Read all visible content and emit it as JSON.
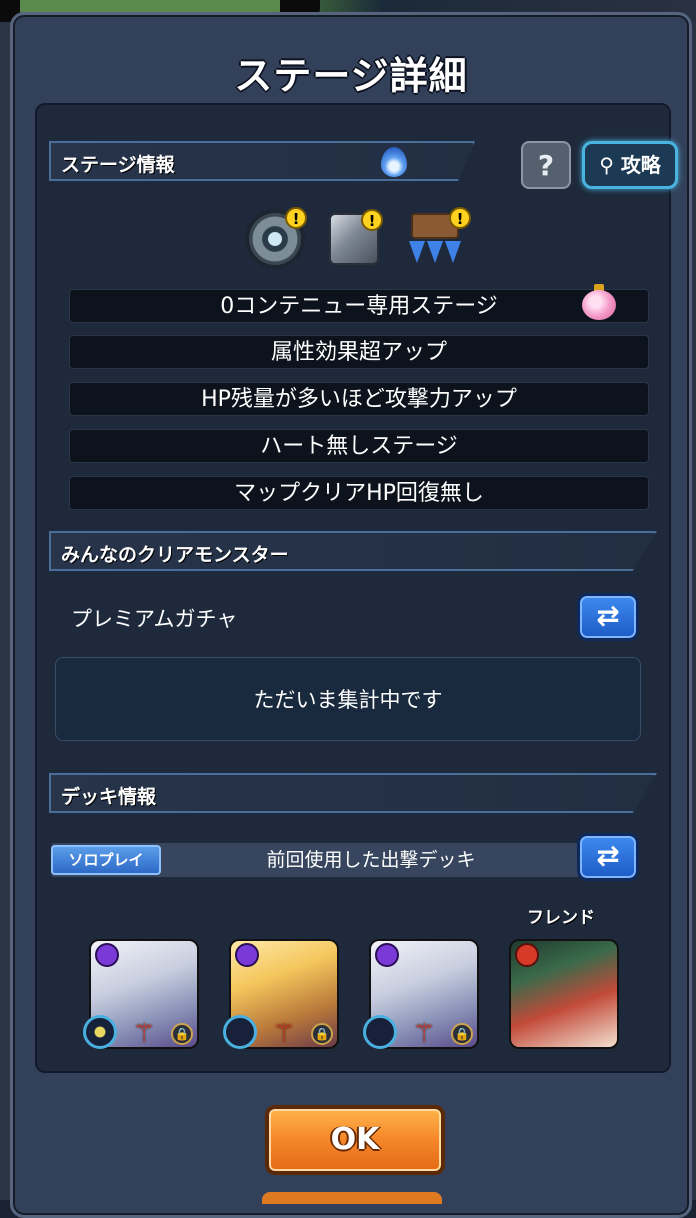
{
  "modal": {
    "title": "ステージ詳細",
    "ok_label": "OK"
  },
  "stage_info": {
    "header": "ステージ情報",
    "help_label": "?",
    "strategy_label": "攻略",
    "element_icon": "water-flame-icon",
    "gimmicks": [
      {
        "name": "mine-icon",
        "warning": "!"
      },
      {
        "name": "block-icon",
        "warning": "!"
      },
      {
        "name": "gravity-barrier-icon",
        "warning": "!"
      }
    ],
    "rules": [
      "0コンテニュー専用ステージ",
      "属性効果超アップ",
      "HP残量が多いほど攻撃力アップ",
      "ハート無しステージ",
      "マップクリアHP回復無し"
    ]
  },
  "clear_monsters": {
    "header": "みんなのクリアモンスター",
    "gacha_label": "プレミアムガチャ",
    "swap_label": "⇄",
    "status": "ただいま集計中です"
  },
  "deck_info": {
    "header": "デッキ情報",
    "mode_badge": "ソロプレイ",
    "deck_name": "前回使用した出撃デッキ",
    "swap_label": "⇄",
    "friend_label": "フレンド",
    "lock_glyph": "🔒",
    "crest_glyph": "⚚"
  },
  "colors": {
    "accent": "#49b4e0",
    "ok_button": "#f5862a",
    "panel": "#1e2a3c"
  }
}
